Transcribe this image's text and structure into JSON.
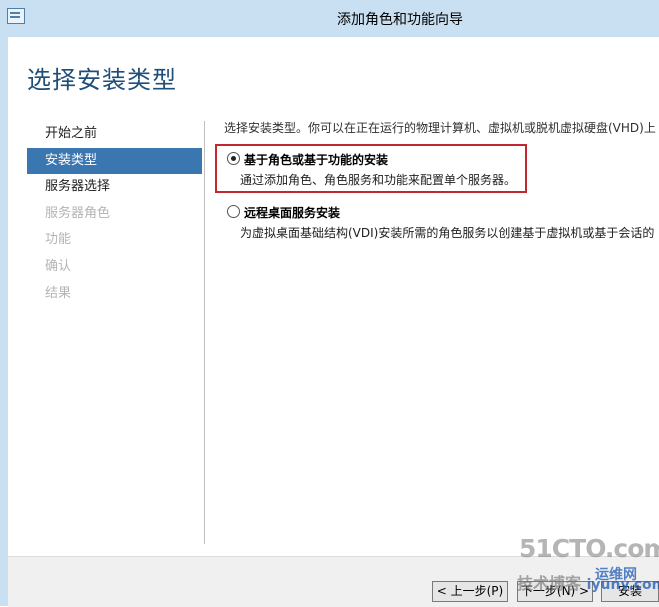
{
  "window": {
    "title": "添加角色和功能向导"
  },
  "page_title": "选择安装类型",
  "nav": {
    "items": [
      {
        "label": "开始之前",
        "state": "normal"
      },
      {
        "label": "安装类型",
        "state": "selected"
      },
      {
        "label": "服务器选择",
        "state": "normal"
      },
      {
        "label": "服务器角色",
        "state": "disabled"
      },
      {
        "label": "功能",
        "state": "disabled"
      },
      {
        "label": "确认",
        "state": "disabled"
      },
      {
        "label": "结果",
        "state": "disabled"
      }
    ]
  },
  "content": {
    "description": "选择安装类型。你可以在正在运行的物理计算机、虚拟机或脱机虚拟硬盘(VHD)上",
    "options": [
      {
        "label": "基于角色或基于功能的安装",
        "description": "通过添加角色、角色服务和功能来配置单个服务器。",
        "selected": true
      },
      {
        "label": "远程桌面服务安装",
        "description": "为虚拟桌面基础结构(VDI)安装所需的角色服务以创建基于虚拟机或基于会话的",
        "selected": false
      }
    ]
  },
  "buttons": {
    "previous": "< 上一步(P)",
    "next": "下一步(N) >",
    "install": "安装"
  },
  "watermark": {
    "brand": "51CTO.com",
    "subtitle": "技术博客",
    "site": "iyunv.com",
    "net": "运维网"
  },
  "colors": {
    "titlebar": "#c9e0f2",
    "selected_nav": "#3a76b0",
    "highlight_border": "#c0282e",
    "heading": "#1f4e79"
  }
}
